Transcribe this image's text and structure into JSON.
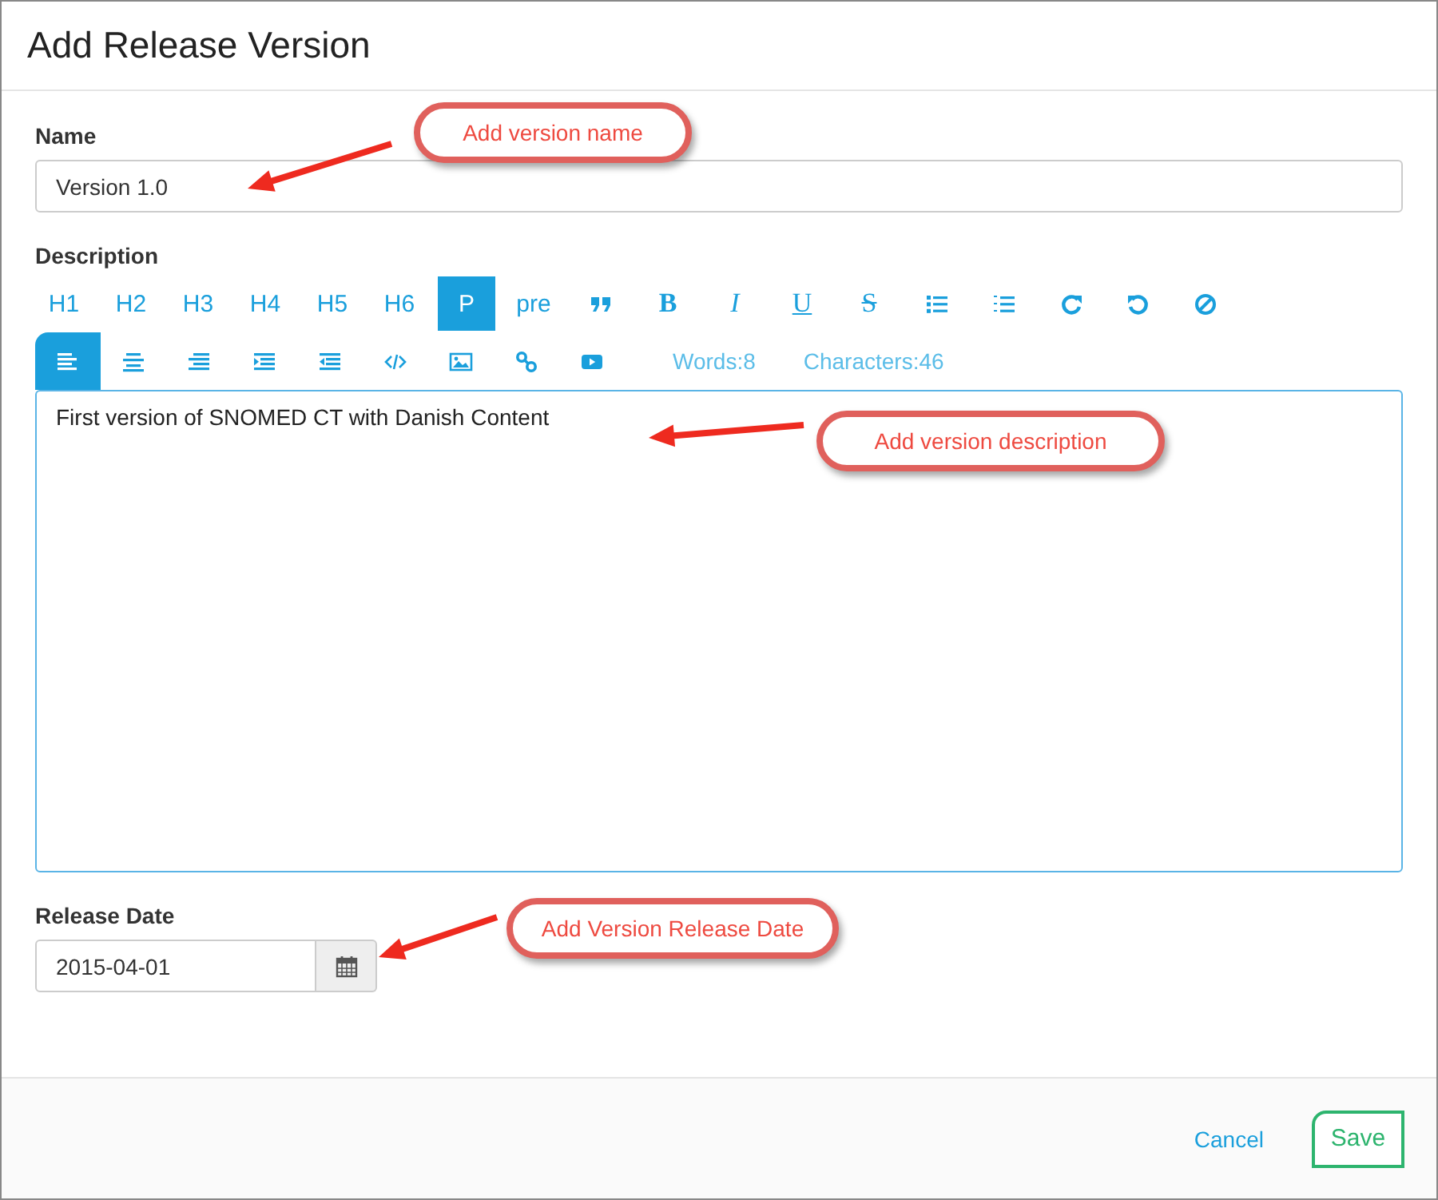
{
  "dialog": {
    "title": "Add Release Version"
  },
  "name_field": {
    "label": "Name",
    "value": "Version 1.0"
  },
  "description": {
    "label": "Description",
    "toolbar_row_1": [
      {
        "kind": "text",
        "label": "H1",
        "selected": false
      },
      {
        "kind": "text",
        "label": "H2",
        "selected": false
      },
      {
        "kind": "text",
        "label": "H3",
        "selected": false
      },
      {
        "kind": "text",
        "label": "H4",
        "selected": false
      },
      {
        "kind": "text",
        "label": "H5",
        "selected": false
      },
      {
        "kind": "text",
        "label": "H6",
        "selected": false
      },
      {
        "kind": "text",
        "label": "P",
        "selected": true
      },
      {
        "kind": "text",
        "label": "pre",
        "selected": false
      },
      {
        "kind": "icon",
        "selected": false
      },
      {
        "kind": "bold",
        "label": "B",
        "selected": false
      },
      {
        "kind": "italic",
        "label": "I",
        "selected": false
      },
      {
        "kind": "underline",
        "label": "U",
        "selected": false
      },
      {
        "kind": "strike",
        "label": "S",
        "selected": false
      },
      {
        "kind": "icon",
        "selected": false
      },
      {
        "kind": "icon",
        "selected": false
      },
      {
        "kind": "icon",
        "selected": false
      },
      {
        "kind": "icon",
        "selected": false
      },
      {
        "kind": "icon",
        "selected": false
      }
    ],
    "toolbar_row_2": [
      {
        "kind": "icon",
        "selected": true
      },
      {
        "kind": "icon",
        "selected": false
      },
      {
        "kind": "icon",
        "selected": false
      },
      {
        "kind": "icon",
        "selected": false
      },
      {
        "kind": "icon",
        "selected": false
      },
      {
        "kind": "icon",
        "selected": false
      },
      {
        "kind": "icon",
        "selected": false
      },
      {
        "kind": "icon",
        "selected": false
      },
      {
        "kind": "icon",
        "selected": false
      }
    ],
    "word_count": "Words:8",
    "char_count": "Characters:46",
    "value": "First version of SNOMED CT with Danish Content"
  },
  "release_date": {
    "label": "Release Date",
    "value": "2015-04-01"
  },
  "buttons": [
    {
      "kind": "link",
      "label": "Cancel"
    },
    {
      "kind": "outline",
      "label": "Save"
    }
  ],
  "annotations": [
    {
      "text": "Add version name"
    },
    {
      "text": "Add version description"
    },
    {
      "text": "Add Version Release Date"
    }
  ]
}
